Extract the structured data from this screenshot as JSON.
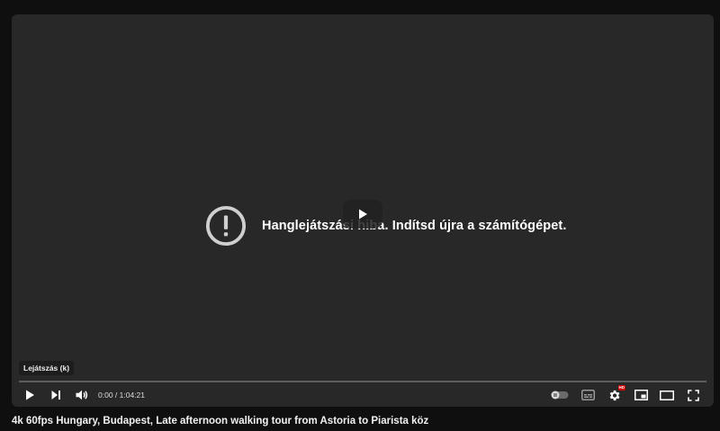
{
  "player": {
    "error_message": "Hanglejátszási hiba. Indítsd újra a számítógépet.",
    "tooltip": "Lejátszás (k)",
    "time_display": "0:00 / 1:04:21",
    "progress_fraction": 0,
    "settings_badge": "HD",
    "icons": {
      "error": "error-circle-icon",
      "big_play": "play-icon",
      "play": "play-icon",
      "next": "skip-next-icon",
      "volume": "volume-icon",
      "autoplay": "autoplay-toggle-icon",
      "subtitles": "subtitles-icon",
      "settings": "gear-icon",
      "miniplayer": "miniplayer-icon",
      "theater": "theater-mode-icon",
      "fullscreen": "fullscreen-icon"
    }
  },
  "video": {
    "title": "4k 60fps Hungary, Budapest, Late afternoon walking tour from Astoria to Piarista köz"
  },
  "colors": {
    "page_background": "#0f0f0f",
    "player_background": "#282828",
    "badge_red": "#cc0000"
  }
}
